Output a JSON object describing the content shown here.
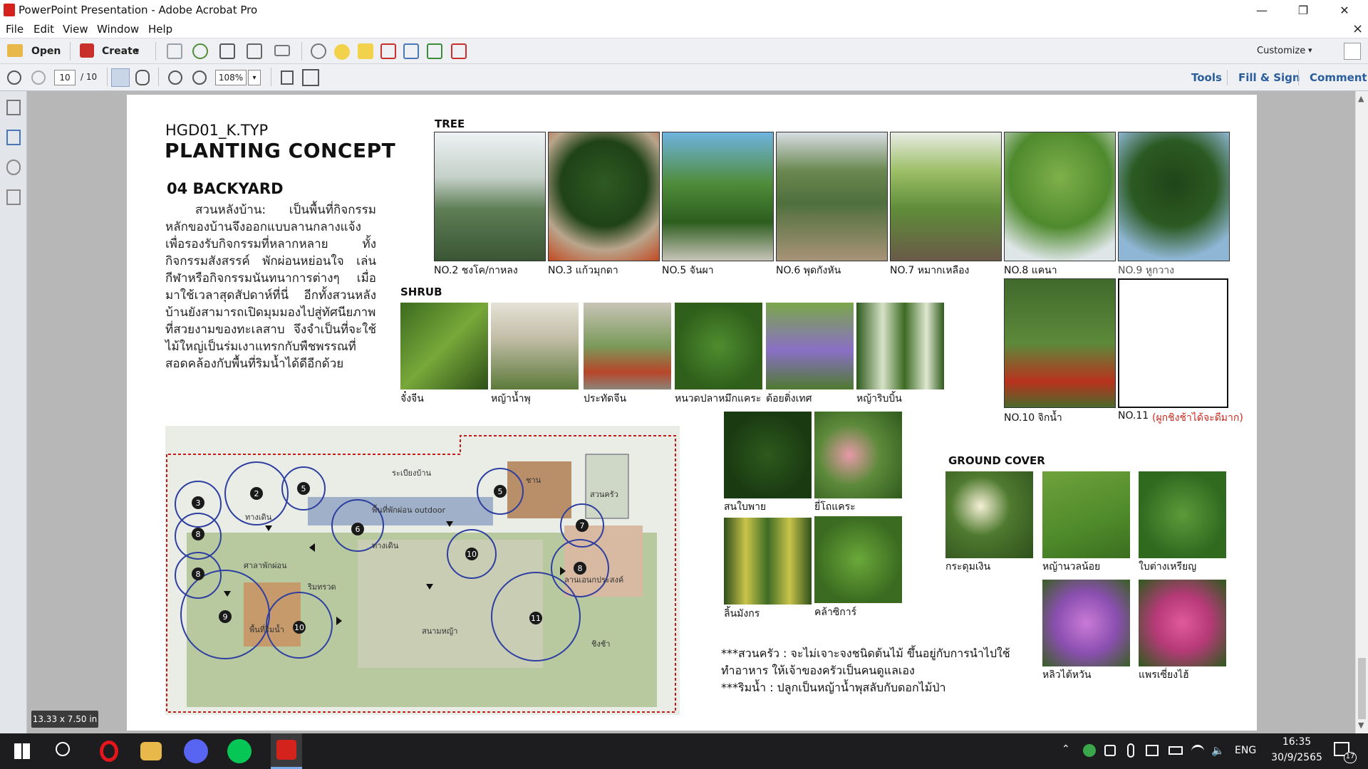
{
  "window": {
    "title": "PowerPoint Presentation - Adobe Acrobat Pro",
    "min_glyph": "—",
    "max_glyph": "❐",
    "close_glyph": "✕",
    "doc_close_glyph": "×"
  },
  "menu": [
    "File",
    "Edit",
    "View",
    "Window",
    "Help"
  ],
  "toolbar": {
    "open_label": "Open",
    "create_label": "Create",
    "create_caret": "▾",
    "customize_label": "Customize",
    "customize_caret": "▾"
  },
  "nav": {
    "page_current": "10",
    "page_total": "/ 10",
    "zoom": "108%",
    "zoom_caret": "▾",
    "tools_label": "Tools",
    "fill_sign_label": "Fill & Sign",
    "comment_label": "Comment"
  },
  "status": {
    "page_size": "13.33 x 7.50 in"
  },
  "page": {
    "code": "HGD01_K.TYP",
    "title": "PLANTING CONCEPT",
    "section_title": "04 BACKYARD",
    "description": "สวนหลังบ้าน: เป็นพื้นที่กิจกรรมหลักของบ้านจึงออกแบบลานกลางแจ้งเพื่อรองรับกิจกรรมที่หลากหลาย ทั้งกิจกรรมสังสรรค์ พักผ่อนหย่อนใจ เล่นกีฬาหรือกิจกรรมนันทนาการต่างๆ เมื่อมาใช้เวลาสุดสัปดาห์ที่นี่ อีกทั้งสวนหลังบ้านยังสามารถเปิดมุมมองไปสู่ทัศนียภาพที่สวยงามของทะเลสาบ จึงจำเป็นที่จะใช้ไม้ใหญ่เป็นร่มเงาแทรกกับพืชพรรณที่สอดคล้องกับพื้นที่ริมน้ำได้ดีอีกด้วย",
    "tree_heading": "TREE",
    "shrub_heading": "SHRUB",
    "ground_heading": "GROUND COVER",
    "trees": [
      {
        "label": "NO.2 ชงโค/กาหลง"
      },
      {
        "label": "NO.3 แก้วมุกดา"
      },
      {
        "label": "NO.5 จันผา"
      },
      {
        "label": "NO.6 พุดกังหัน"
      },
      {
        "label": "NO.7 หมากเหลือง"
      },
      {
        "label": "NO.8 แคนา"
      },
      {
        "label": "NO.9 หูกวาง"
      }
    ],
    "tree10": {
      "label": "NO.10 จิกน้ำ"
    },
    "tree11": {
      "label": "NO.11",
      "note": "(ผูกชิงช้าได้จะดีมาก)"
    },
    "shrubs": [
      {
        "label": "จั๋งจีน"
      },
      {
        "label": "หญ้าน้ำพุ"
      },
      {
        "label": "ประทัดจีน"
      },
      {
        "label": "หนวดปลาหมึกแคระ"
      },
      {
        "label": "ต้อยติ่งเทศ"
      },
      {
        "label": "หญ้าริบบิ้น"
      }
    ],
    "shrubs2": [
      {
        "label": "สนใบพาย"
      },
      {
        "label": "ยี่โถแคระ"
      },
      {
        "label": "ลิ้นมังกร"
      },
      {
        "label": "คล้าซิการ์"
      }
    ],
    "grounds": [
      {
        "label": "กระดุมเงิน"
      },
      {
        "label": "หญ้านวลน้อย"
      },
      {
        "label": "ใบต่างเหรียญ"
      },
      {
        "label": "หลิวไต้หวัน"
      },
      {
        "label": "แพรเซี่ยงไฮ้"
      }
    ],
    "notes": [
      "***สวนครัว : จะไม่เจาะจงชนิดต้นไม้ ขึ้นอยู่กับการนำไปใช้ทำอาหาร ให้เจ้าของครัวเป็นคนดูแลเอง",
      "***ริมน้ำ : ปลูกเป็นหญ้าน้ำพุสลับกับดอกไม้ป่า"
    ],
    "plan": {
      "labels": [
        "ระเบียงบ้าน",
        "ทางเดิน",
        "พื้นที่พักผ่อน outdoor",
        "ทางเดิน",
        "ศาลาพักผ่อน",
        "ริมทรวด",
        "สนามหญ้า",
        "พื้นที่ริมน้ำ",
        "ลานเอนกประสงค์",
        "ชาน",
        "สวนครัว",
        "ชิงช้า"
      ],
      "markers": [
        "2",
        "3",
        "5",
        "5",
        "6",
        "7",
        "8",
        "8",
        "8",
        "9",
        "10",
        "10",
        "11"
      ]
    }
  },
  "taskbar": {
    "lang": "ENG",
    "time": "16:35",
    "date": "30/9/2565",
    "notif_count": "17"
  }
}
